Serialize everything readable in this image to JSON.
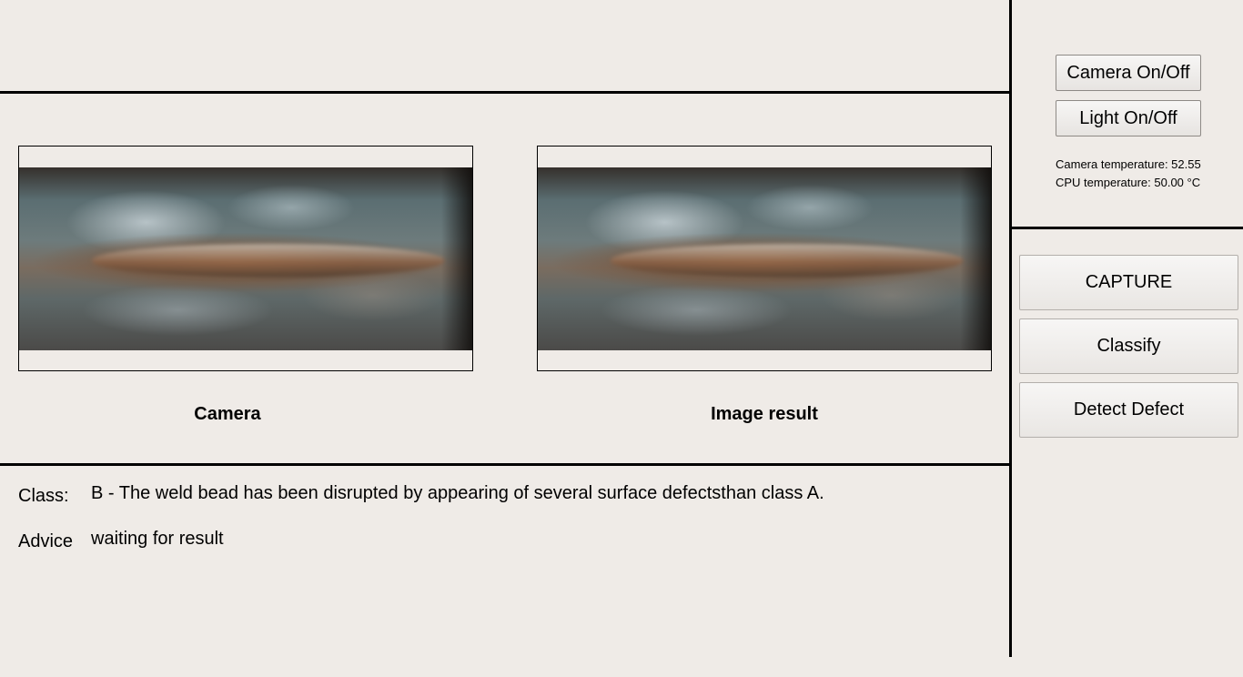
{
  "camera_panel": {
    "caption": "Camera"
  },
  "result_panel": {
    "caption": "Image result"
  },
  "info": {
    "class_label": "Class:",
    "class_value": "B - The weld bead has been disrupted by appearing of several surface defectsthan class A.",
    "advice_label": "Advice",
    "advice_value": "waiting for result"
  },
  "controls": {
    "camera_toggle": "Camera On/Off",
    "light_toggle": "Light On/Off",
    "camera_temperature": "Camera temperature: 52.55",
    "cpu_temperature": "CPU temperature: 50.00 °C",
    "capture": "CAPTURE",
    "classify": "Classify",
    "detect_defect": "Detect Defect"
  }
}
